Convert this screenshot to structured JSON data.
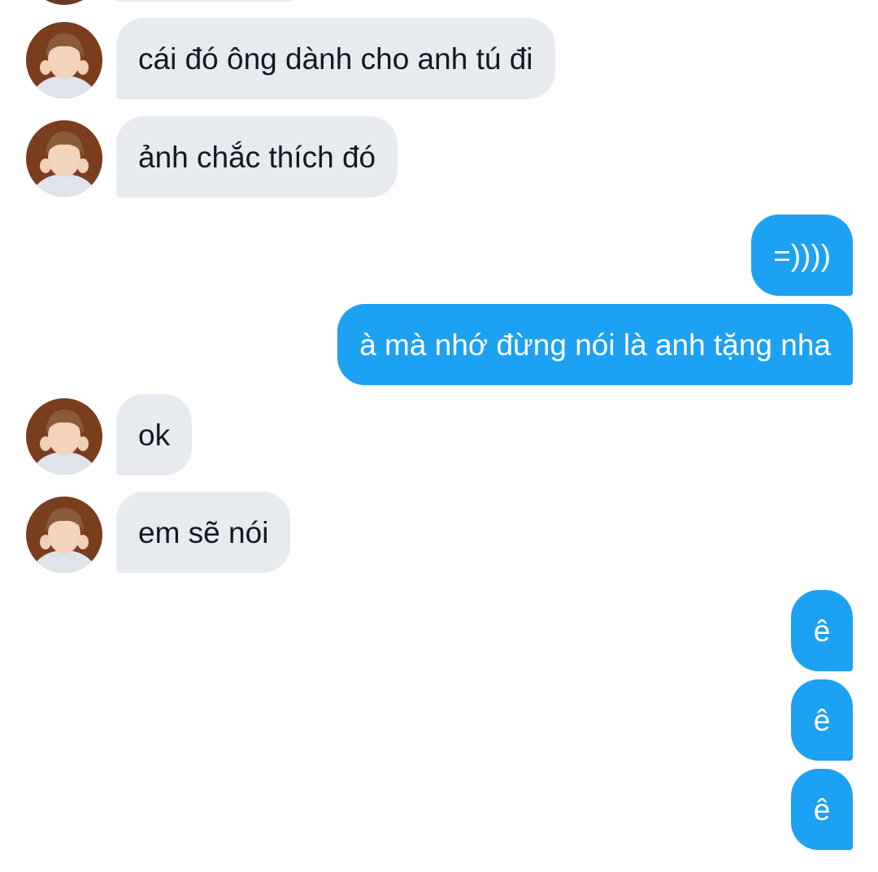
{
  "conversation": {
    "messages": [
      {
        "sender": "them",
        "text": "cái đó ông dành cho anh tú đi"
      },
      {
        "sender": "them",
        "text": "ảnh chắc thích đó"
      },
      {
        "sender": "me",
        "text": "=))))"
      },
      {
        "sender": "me",
        "text": "à mà nhớ đừng nói là anh tặng nha"
      },
      {
        "sender": "them",
        "text": "ok"
      },
      {
        "sender": "them",
        "text": "em sẽ nói"
      },
      {
        "sender": "me",
        "text": "ê"
      },
      {
        "sender": "me",
        "text": "ê"
      },
      {
        "sender": "me",
        "text": "ê"
      }
    ]
  },
  "colors": {
    "incoming_bubble": "#e7ebf0",
    "outgoing_bubble": "#1da1f2",
    "incoming_text": "#141823",
    "outgoing_text": "#ffffff",
    "background": "#ffffff"
  }
}
